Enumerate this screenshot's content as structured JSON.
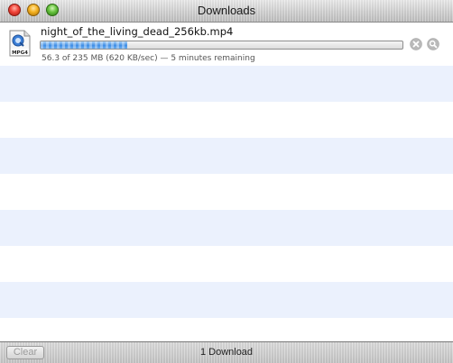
{
  "window": {
    "title": "Downloads"
  },
  "downloads": [
    {
      "filename": "night_of_the_living_dead_256kb.mp4",
      "file_type_badge": "MPG4",
      "progress_fraction": 0.24,
      "status": "56.3 of 235 MB (620 KB/sec) — 5 minutes remaining",
      "icon": "quicktime-document-icon"
    }
  ],
  "footer": {
    "clear_label": "Clear",
    "count_label": "1 Download"
  },
  "colors": {
    "stripe_blue": "#ebf1fd",
    "progress_blue": "#3f8ee6"
  }
}
